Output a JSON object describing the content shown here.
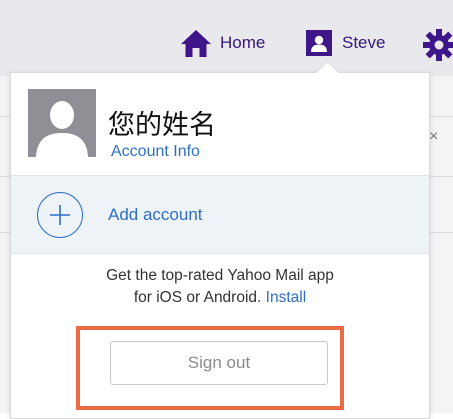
{
  "header": {
    "home_label": "Home",
    "user_label": "Steve",
    "icons": [
      "home-icon",
      "user-icon",
      "gear-icon",
      "close-icon"
    ]
  },
  "close_glyph": "×",
  "dropdown": {
    "account_name": "您的姓名",
    "account_info_link": "Account Info",
    "add_account_label": "Add account",
    "promo_line1": "Get the top-rated Yahoo Mail app",
    "promo_line2": "for iOS or Android.",
    "promo_install_link": "Install",
    "sign_out_label": "Sign out"
  },
  "colors": {
    "brand_purple": "#3f168a",
    "link_blue": "#2f6fc4",
    "highlight": "#ec6b45",
    "topbar_bg": "#e9e8ec"
  }
}
